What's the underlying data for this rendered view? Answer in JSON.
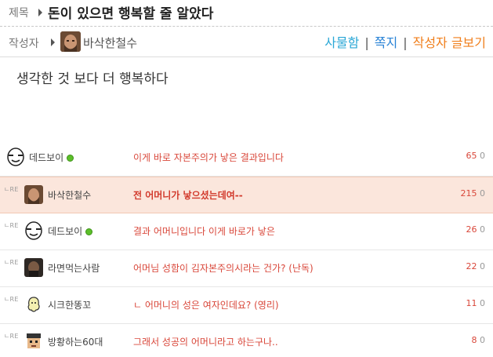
{
  "post": {
    "title_label": "제목",
    "title": "돈이 있으면 행복할 줄 알았다",
    "author_label": "작성자",
    "author_name": "바삭한철수",
    "links": {
      "gift_box": "사물함",
      "message": "쪽지",
      "author_posts": "작성자 글보기",
      "separator": "|"
    },
    "content": "생각한 것 보다 더 행복하다"
  },
  "comments": [
    {
      "is_reply": false,
      "name": "데드보이",
      "online": true,
      "avatar": "bald-face",
      "text": "이게 바로 자본주의가 낳은 결과입니다",
      "likes": "65",
      "dislikes": "0",
      "highlight": false
    },
    {
      "is_reply": true,
      "re_label": "ㄴRE",
      "name": "바삭한철수",
      "online": false,
      "avatar": "man-photo",
      "text": "전 어머니가 낳으셨는데여--",
      "likes": "215",
      "dislikes": "0",
      "highlight": true
    },
    {
      "is_reply": true,
      "re_label": "ㄴRE",
      "name": "데드보이",
      "online": true,
      "avatar": "bald-face",
      "text": "결과 어머니입니다 이게 바로가 낳은",
      "likes": "26",
      "dislikes": "0",
      "highlight": false
    },
    {
      "is_reply": true,
      "re_label": "ㄴRE",
      "name": "라면먹는사람",
      "online": false,
      "avatar": "dark-photo",
      "text": "어머님 성함이 김자본주의시라는 건가? (난독)",
      "likes": "22",
      "dislikes": "0",
      "highlight": false
    },
    {
      "is_reply": true,
      "re_label": "ㄴRE",
      "name": "시크한똥꼬",
      "online": false,
      "avatar": "ghost-doodle",
      "text": "ㄴ 어머니의 성은 여자인데요? (영리)",
      "likes": "11",
      "dislikes": "0",
      "highlight": false
    },
    {
      "is_reply": true,
      "re_label": "ㄴRE",
      "name": "방황하는60대",
      "online": false,
      "avatar": "pixel-face",
      "text": "그래서 성공의 어머니라고 하는구나..",
      "likes": "8",
      "dislikes": "0",
      "highlight": false
    }
  ]
}
